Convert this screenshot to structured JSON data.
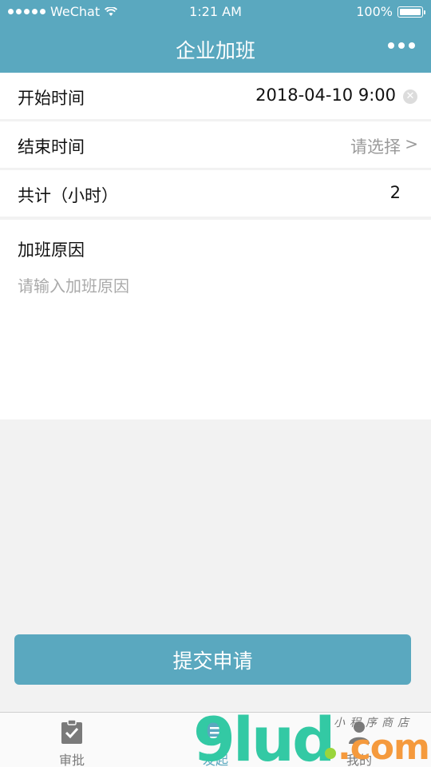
{
  "status_bar": {
    "carrier": "WeChat",
    "time": "1:21 AM",
    "battery": "100%"
  },
  "nav": {
    "title": "企业加班",
    "more_icon": "more-dots-icon"
  },
  "form": {
    "start_time": {
      "label": "开始时间",
      "value": "2018-04-10 9:00",
      "clear_icon": "clear-icon"
    },
    "end_time": {
      "label": "结束时间",
      "placeholder": "请选择",
      "chevron": ">"
    },
    "total_hours": {
      "label": "共计（小时）",
      "value": "2"
    },
    "reason": {
      "label": "加班原因",
      "placeholder": "请输入加班原因"
    }
  },
  "submit_label": "提交申请",
  "tabs": [
    {
      "label": "审批",
      "icon": "clipboard-check-icon",
      "active": false
    },
    {
      "label": "发起",
      "icon": "document-list-icon",
      "active": true
    },
    {
      "label": "我的",
      "icon": "user-icon",
      "active": false
    }
  ],
  "watermark": {
    "main": "9lud",
    "suffix": ".com",
    "sub": "小程序商店"
  },
  "colors": {
    "brand": "#5aa8bf",
    "background": "#f2f2f2"
  }
}
